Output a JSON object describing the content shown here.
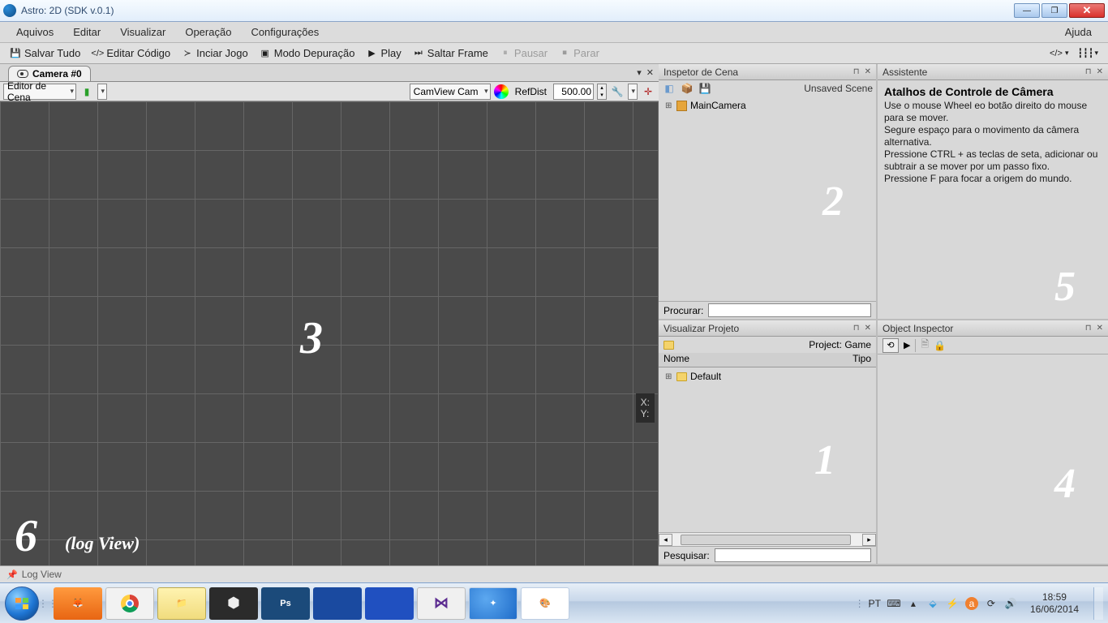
{
  "window": {
    "title": "Astro: 2D (SDK v.0.1)"
  },
  "menubar": {
    "aquivos": "Aquivos",
    "editar": "Editar",
    "visualizar": "Visualizar",
    "operacao": "Operação",
    "config": "Configurações",
    "ajuda": "Ajuda"
  },
  "toolbar": {
    "salvar": "Salvar Tudo",
    "editar_codigo": "Editar Código",
    "iniciar_jogo": "Inciar Jogo",
    "modo_dep": "Modo Depuração",
    "play": "Play",
    "saltar": "Saltar Frame",
    "pausar": "Pausar",
    "parar": "Parar"
  },
  "camera_tab": {
    "label": "Camera #0"
  },
  "viewport_toolbar": {
    "editor_dd": "Editor de Cena",
    "camview_dd": "CamView Cam",
    "refdist_label": "RefDist",
    "refdist_value": "500.00"
  },
  "viewport": {
    "overlay3": "3",
    "overlay6": "6",
    "logview_label": "(log View)",
    "coords_x": "X:",
    "coords_y": "Y:"
  },
  "scene_inspector": {
    "title": "Inspetor de Cena",
    "status": "Unsaved Scene",
    "item_main_camera": "MainCamera",
    "procurar_label": "Procurar:",
    "overlay2": "2"
  },
  "project_view": {
    "title": "Visualizar Projeto",
    "project_label": "Project: Game",
    "col_nome": "Nome",
    "col_tipo": "Tipo",
    "item_default": "Default",
    "pesquisar_label": "Pesquisar:",
    "overlay1": "1"
  },
  "assistant": {
    "title": "Assistente",
    "heading": "Atalhos de Controle de Câmera",
    "line1": "Use o mouse Wheel eo botão direito do mouse para se mover.",
    "line2": "Segure espaço para o movimento da câmera alternativa.",
    "line3": "Pressione CTRL + as teclas de seta, adicionar ou subtrair a se mover por um passo fixo.",
    "line4": "Pressione F para focar a origem do mundo.",
    "overlay5": "5"
  },
  "object_inspector": {
    "title": "Object Inspector",
    "overlay4": "4"
  },
  "logview_bar": {
    "label": "Log View"
  },
  "taskbar": {
    "lang": "PT",
    "time": "18:59",
    "date": "16/06/2014"
  }
}
